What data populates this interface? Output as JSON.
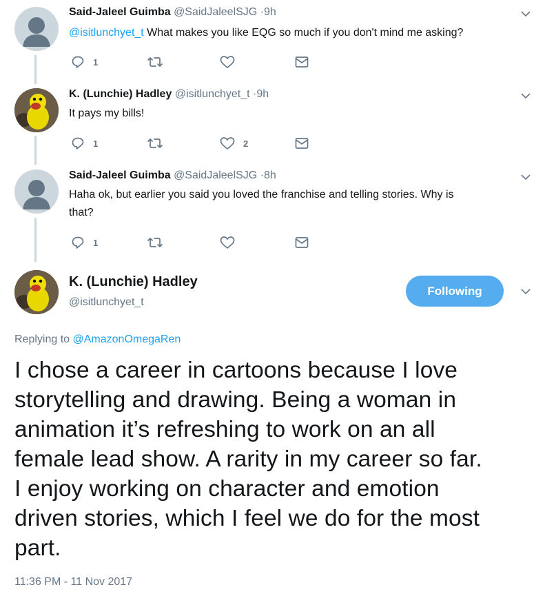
{
  "tweets": [
    {
      "name": "Said-Jaleel Guimba",
      "handle": "@SaidJaleelSJG",
      "time": "·9h",
      "mention": "@isitlunchyet_t",
      "text": " What makes you like EQG so much if you don't mind me asking?",
      "reply_count": "1",
      "retweet_count": "",
      "like_count": ""
    },
    {
      "name": "K. (Lunchie) Hadley",
      "handle": "@isitlunchyet_t",
      "time": "·9h",
      "text": "It pays my bills!",
      "reply_count": "1",
      "retweet_count": "",
      "like_count": "2"
    },
    {
      "name": "Said-Jaleel Guimba",
      "handle": "@SaidJaleelSJG",
      "time": "·8h",
      "text_line1": "Haha ok, but earlier you said you loved the franchise and telling stories. Why is",
      "text_line2": "that?",
      "reply_count": "1",
      "retweet_count": "",
      "like_count": ""
    }
  ],
  "main": {
    "name": "K. (Lunchie) Hadley",
    "handle": "@isitlunchyet_t",
    "follow_label": "Following",
    "replying_prefix": "Replying to ",
    "replying_to": "@AmazonOmegaRen",
    "text_lines": [
      "I chose a career in cartoons because I love",
      "storytelling and drawing. Being a woman in",
      "animation it’s refreshing to work on an all",
      "female lead show. A rarity in my career so far.",
      "I enjoy working on character and emotion",
      "driven stories, which I feel we do for the most",
      "part."
    ],
    "timestamp": "11:36 PM - 11 Nov 2017"
  },
  "icons": {
    "reply": "reply-icon",
    "retweet": "retweet-icon",
    "like": "heart-icon",
    "dm": "envelope-icon",
    "more": "chevron-down-icon"
  },
  "colors": {
    "accent": "#1da1f2",
    "follow_button": "#55acee",
    "muted": "#657786",
    "thread_line": "#ccd6dd"
  }
}
